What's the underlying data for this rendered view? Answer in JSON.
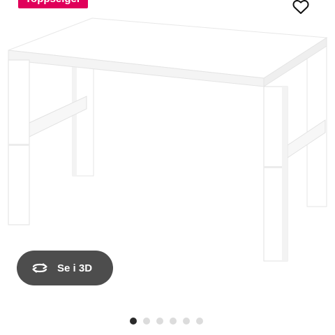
{
  "badge": {
    "label": "Toppselger"
  },
  "favorite": {
    "icon": "heart-icon"
  },
  "product": {
    "image_icon": "desk-image"
  },
  "view3d": {
    "label": "Se i 3D",
    "icon": "rotate-3d-icon"
  },
  "carousel": {
    "count": 6,
    "active_index": 0
  },
  "colors": {
    "badge": "#e0005a",
    "button": "#4d4d4d",
    "dot_active": "#2a2a2a",
    "dot_inactive": "#dcdcdc"
  }
}
